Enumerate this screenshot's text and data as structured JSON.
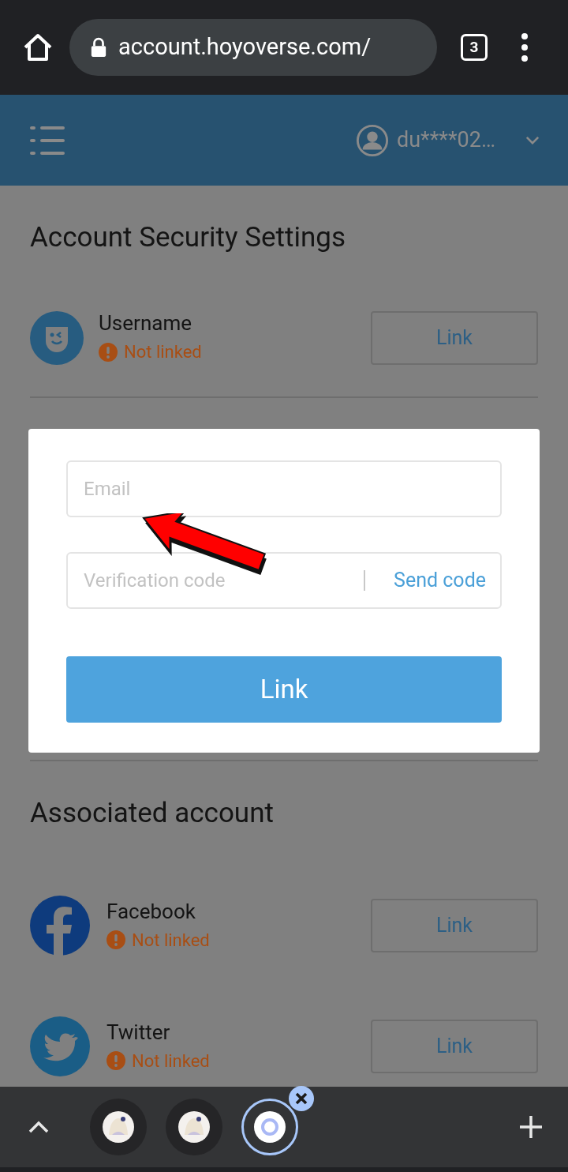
{
  "browser": {
    "url": "account.hoyoverse.com/",
    "tab_count": "3"
  },
  "header": {
    "username": "du****02…"
  },
  "page": {
    "title": "Account Security Settings",
    "security_items": [
      {
        "kind": "username",
        "label": "Username",
        "status": "Not linked",
        "button": "Link"
      }
    ],
    "associated_title": "Associated account",
    "accounts": [
      {
        "kind": "facebook",
        "label": "Facebook",
        "status": "Not linked",
        "button": "Link"
      },
      {
        "kind": "twitter",
        "label": "Twitter",
        "status": "Not linked",
        "button": "Link"
      }
    ]
  },
  "modal": {
    "email_placeholder": "Email",
    "code_placeholder": "Verification code",
    "send_code": "Send code",
    "submit": "Link"
  },
  "tab_strip": {
    "tabs": [
      {
        "kind": "thumbnail",
        "selected": false
      },
      {
        "kind": "thumbnail",
        "selected": false
      },
      {
        "kind": "loading",
        "selected": true
      }
    ]
  }
}
